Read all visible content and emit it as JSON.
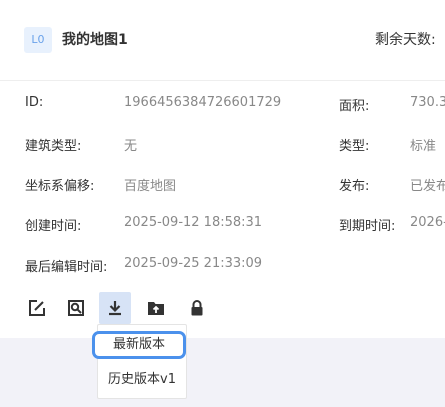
{
  "header": {
    "level_badge": "L0",
    "map_name": "我的地图1",
    "remaining_days_label": "剩余天数:"
  },
  "info": {
    "id": {
      "label": "ID:",
      "value": "1966456384726601729"
    },
    "area": {
      "label": "面积:",
      "value": "730.3"
    },
    "building_type": {
      "label": "建筑类型:",
      "value": "无"
    },
    "type": {
      "label": "类型:",
      "value": "标准"
    },
    "coord_offset": {
      "label": "坐标系偏移:",
      "value": "百度地图"
    },
    "publish": {
      "label": "发布:",
      "value": "已发布"
    },
    "created_time": {
      "label": "创建时间:",
      "value": "2025-09-12 18:58:31"
    },
    "expire_time": {
      "label": "到期时间:",
      "value": "2026-"
    },
    "last_edit_time": {
      "label": "最后编辑时间:",
      "value": "2025-09-25 21:33:09"
    }
  },
  "toolbar": {
    "icons": [
      "edit-icon",
      "preview-icon",
      "download-icon",
      "upload-folder-icon",
      "lock-icon"
    ],
    "active": "download-icon"
  },
  "dropdown": {
    "items": [
      "最新版本",
      "历史版本v1"
    ]
  },
  "colors": {
    "icon": "#333333",
    "active_bg": "#d7e3f6",
    "highlight_border": "#4b91ec",
    "badge_bg": "#e8f1fd",
    "badge_text": "#6aa2ea"
  }
}
